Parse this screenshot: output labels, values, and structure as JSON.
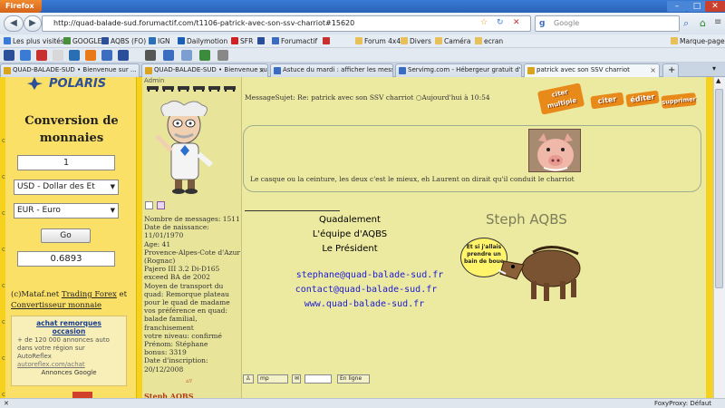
{
  "titlebar": {
    "app": "Firefox"
  },
  "nav": {
    "url": "http://quad-balade-sud.forumactif.com/t1106-patrick-avec-son-ssv-charriot#15620",
    "search_placeholder": "Google"
  },
  "bookmarks": [
    {
      "label": "Les plus visités",
      "color": "#3b7bd8"
    },
    {
      "label": "GOOGLE",
      "color": "#4a8f3c"
    },
    {
      "label": "AQBS (FO)",
      "color": "#2c4f9a"
    },
    {
      "label": "IGN",
      "color": "#2c6fb4"
    },
    {
      "label": "Dailymotion",
      "color": "#1a5fb4"
    },
    {
      "label": "SFR",
      "color": "#d22020"
    },
    {
      "label": "",
      "color": "#2a4e9a"
    },
    {
      "label": "Forumactif",
      "color": "#3a6cc0"
    },
    {
      "label": "",
      "color": "#c83030"
    },
    {
      "label": "Forum 4x4",
      "color": "#e8c05a"
    },
    {
      "label": "Divers",
      "color": "#e8c05a"
    },
    {
      "label": "Caméra",
      "color": "#e8c05a"
    },
    {
      "label": "ecran",
      "color": "#e8c05a"
    },
    {
      "label": "Marque-pages",
      "color": "#e8c05a"
    }
  ],
  "tabs": [
    {
      "label": "QUAD-BALADE-SUD • Bienvenue sur ...",
      "color": "#d9a520"
    },
    {
      "label": "QUAD-BALADE-SUD • Bienvenue sur ...",
      "color": "#d9a520"
    },
    {
      "label": "Astuce du mardi : afficher les message...",
      "color": "#3a6cc0"
    },
    {
      "label": "Servimg.com - Hébergeur gratuit d'i...",
      "color": "#3a6cc0"
    },
    {
      "label": "patrick avec son SSV charriot",
      "color": "#d9a520"
    }
  ],
  "converter": {
    "title_line1": "Conversion de",
    "title_line2": "monnaies",
    "amount": "1",
    "from": "USD - Dollar des Et",
    "to": "EUR - Euro",
    "go": "Go",
    "result": "0.6893",
    "credit_prefix": "(c)Mataf.net ",
    "credit_link1": "Trading Forex",
    "credit_mid": " et ",
    "credit_link2": "Convertisseur monnaie"
  },
  "ad": {
    "heading_line1": "achat remorques",
    "heading_line2": "occasion",
    "body": "+ de 120 000 annonces auto dans votre région sur AutoReflex",
    "url": "autoreflex.com/achat",
    "google": "Annonces Google"
  },
  "profile": {
    "username": "Admin",
    "lines": [
      "Nombre de messages: 1511",
      "Date de naissance: 11/01/1970",
      "Age: 41",
      "Provence-Alpes-Cote d'Azur (Rognac)",
      "Pajero III 3.2 Di-D165 exceed BA de 2002",
      "Moyen de transport du quad: Remorque plateau pour le quad de madame",
      "vos préférence en quad: balade familial, franchisement",
      "votre niveau: confirmé",
      "Prénom: Stéphane",
      "bonus: 3319",
      "Date d'inscription: 20/12/2008"
    ]
  },
  "post": {
    "header": "MessageSujet: Re: patrick avec son SSV charriot ○Aujourd'hui à 10:54",
    "body": "Le casque ou la ceinture, les deux c'est le mieux, eh Laurent on dirait qu'il conduit le charriot"
  },
  "post_buttons": [
    "citer multiple",
    "citer",
    "éditer",
    "supprimer"
  ],
  "signature": {
    "line1": "Quadalement",
    "line2": "L'équipe d'AQBS",
    "line3": "Le Président",
    "email1": "stephane@quad-balade-sud.fr",
    "email2": "contact@quad-balade-sud.fr",
    "website": "www.quad-balade-sud.fr",
    "banner": "Steph AQBS",
    "bubble": "Et si j'allais prendre un bain de boue"
  },
  "post_footer": {
    "mp": "mp",
    "online": "En ligne"
  },
  "next_author": "Steph AQBS",
  "status": {
    "proxy": "FoxyProxy: Défaut"
  }
}
